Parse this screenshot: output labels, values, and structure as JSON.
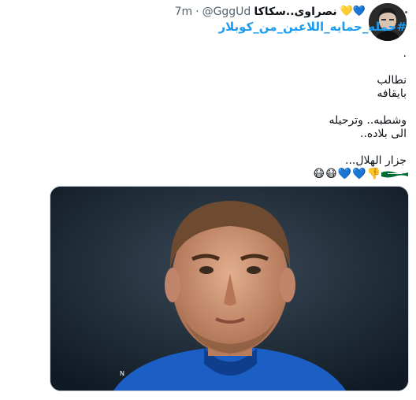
{
  "tweet": {
    "display_name": "نصراوى..سكاكا",
    "name_emojis": "💛💙",
    "handle": "@GggUd",
    "separator": "·",
    "time": "7m",
    "hashtag": "#حمله_حمايه_اللاعبن_من_كوبلار",
    "lines": [
      ".",
      "",
      "نطالب",
      "بايقافه",
      "",
      "وشطبه.. وترحيله",
      "الى بلاده..",
      "",
      "جزار الهلال..."
    ],
    "emoji_line": [
      "👎",
      "💙",
      "💙",
      "😷",
      "😷"
    ]
  },
  "icons": {
    "more": "more-horizontal-icon",
    "avatar": "avatar-photo",
    "flag": "saudi-flag-icon",
    "media": "player-photo"
  },
  "colors": {
    "accent": "#1d9bf0",
    "text": "#0f1419",
    "muted": "#536471",
    "kit_blue": "#1b5fc4",
    "flag_green": "#006c35"
  }
}
